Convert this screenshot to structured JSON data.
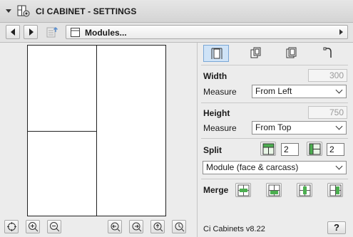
{
  "title": "CI CABINET - SETTINGS",
  "toolbar": {
    "module_selector": "Modules..."
  },
  "tabs": [
    {
      "icon": "module-size-icon",
      "active": true
    },
    {
      "icon": "door-front-icon",
      "active": false
    },
    {
      "icon": "drawer-front-icon",
      "active": false
    },
    {
      "icon": "handle-icon",
      "active": false
    }
  ],
  "width": {
    "label": "Width",
    "value": "300",
    "measure_label": "Measure",
    "measure_value": "From Left"
  },
  "height": {
    "label": "Height",
    "value": "750",
    "measure_label": "Measure",
    "measure_value": "From Top"
  },
  "split": {
    "label": "Split",
    "horizontal_count": "2",
    "vertical_count": "2",
    "mode": "Module (face & carcass)"
  },
  "merge": {
    "label": "Merge"
  },
  "footer": {
    "version": "Ci Cabinets v8.22",
    "help": "?"
  },
  "colors": {
    "active_tab": "#cfe3f7",
    "accent_green": "#3fa43a"
  }
}
